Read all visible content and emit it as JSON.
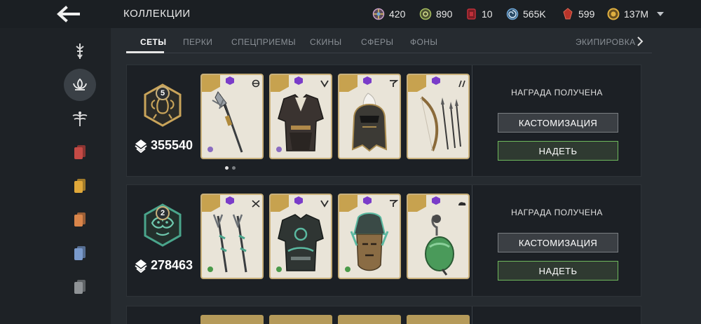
{
  "header": {
    "title": "КОЛЛЕКЦИИ",
    "currencies": [
      {
        "id": "orb",
        "icon": "orb-icon",
        "value": "420",
        "color": "#c8a0c8"
      },
      {
        "id": "coin-green",
        "icon": "green-coin-icon",
        "value": "890",
        "color": "#a8c060"
      },
      {
        "id": "ruby",
        "icon": "red-card-icon",
        "value": "10",
        "color": "#c0303a"
      },
      {
        "id": "swirl",
        "icon": "swirl-icon",
        "value": "565K",
        "color": "#6fa8d8"
      },
      {
        "id": "gem",
        "icon": "red-gem-icon",
        "value": "599",
        "color": "#d84a3a"
      },
      {
        "id": "gold",
        "icon": "gold-coin-icon",
        "value": "137M",
        "color": "#e0b040"
      }
    ]
  },
  "sidebar": {
    "items": [
      {
        "name": "sword-emblem-icon",
        "active": false
      },
      {
        "name": "lotus-icon",
        "active": true
      },
      {
        "name": "dragonfly-icon",
        "active": false
      },
      {
        "name": "red-cards-icon",
        "color": "#c44a45",
        "active": false
      },
      {
        "name": "yellow-cards-icon",
        "color": "#e0a83a",
        "active": false
      },
      {
        "name": "orange-cards-icon",
        "color": "#d9854a",
        "active": false
      },
      {
        "name": "blue-cards-icon",
        "color": "#7a9acb",
        "active": false
      },
      {
        "name": "grey-cards-icon",
        "color": "#8f9396",
        "active": false
      }
    ]
  },
  "tabs": [
    {
      "label": "СЕТЫ",
      "active": true
    },
    {
      "label": "ПЕРКИ",
      "active": false
    },
    {
      "label": "СПЕЦПРИЕМЫ",
      "active": false
    },
    {
      "label": "СКИНЫ",
      "active": false
    },
    {
      "label": "СФЕРЫ",
      "active": false
    },
    {
      "label": "ФОНЫ",
      "active": false
    },
    {
      "label": "ЭКИПИРОВКА",
      "active": false
    }
  ],
  "sets": [
    {
      "rank": "5",
      "power": "355540",
      "emblem_color": "#c9a45a",
      "items": [
        "spear",
        "armor",
        "helmet",
        "bow"
      ],
      "reward_status": "НАГРАДА ПОЛУЧЕНА",
      "customize_label": "КАСТОМИЗАЦИЯ",
      "equip_label": "НАДЕТЬ",
      "pages": 2,
      "current_page": 1
    },
    {
      "rank": "2",
      "power": "278463",
      "emblem_color": "#4aa58c",
      "items": [
        "trident",
        "armor",
        "helmet",
        "ranged"
      ],
      "reward_status": "НАГРАДА ПОЛУЧЕНА",
      "customize_label": "КАСТОМИЗАЦИЯ",
      "equip_label": "НАДЕТЬ"
    }
  ]
}
